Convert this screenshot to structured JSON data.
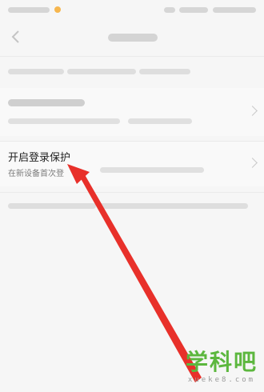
{
  "colors": {
    "accent_status_dot": "#f6b64e",
    "arrow": "#e8302a",
    "watermark_green": "#5cb73e"
  },
  "icons": {
    "back": "chevron-left-icon",
    "row_chevron": "chevron-right-icon",
    "arrow": "red-pointer-arrow"
  },
  "login_protection": {
    "title": "开启登录保护",
    "subtitle": "在新设备首次登"
  },
  "watermark": {
    "text": "学科吧",
    "url": "xueke8.com"
  }
}
